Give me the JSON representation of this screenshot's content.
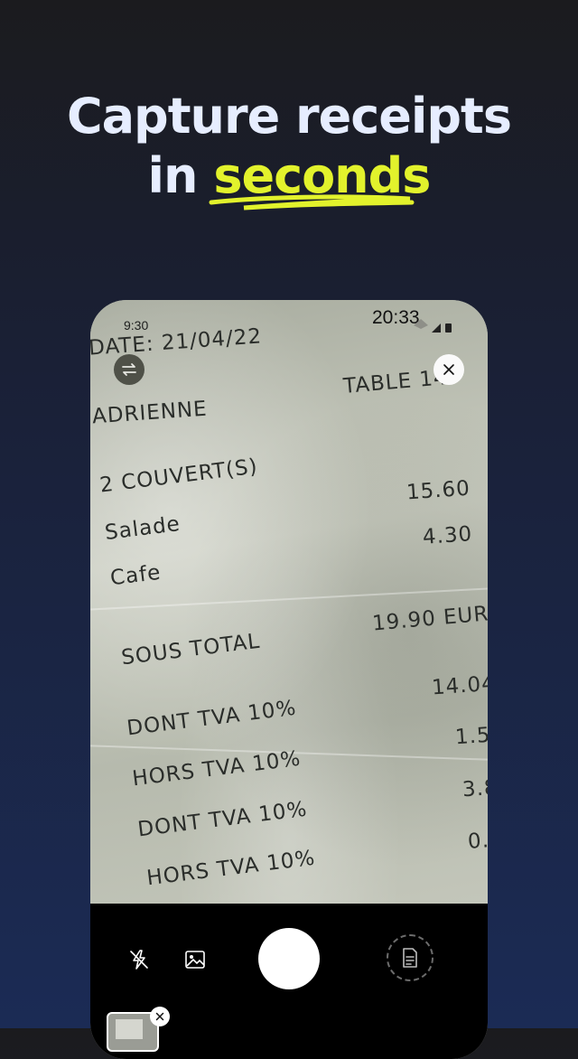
{
  "headline": {
    "line1": "Capture receipts",
    "line2_prefix": "in",
    "line2_accent": "seconds"
  },
  "colors": {
    "accent": "#e2f22c",
    "headline": "#e6edff",
    "background_bottom": "#1b2b55"
  },
  "phone": {
    "status_time": "9:30",
    "status_time_overlay": "20:33",
    "receipt": {
      "date": "DATE: 21/04/22",
      "table": "TABLE 14",
      "server": "ADRIENNE",
      "covers": "2 COUVERT(S)",
      "items": [
        {
          "name": "Salade",
          "amount": "15.60"
        },
        {
          "name": "Cafe",
          "amount": "4.30"
        }
      ],
      "subtotal_label": "SOUS TOTAL",
      "subtotal_value": "19.90 EUR",
      "tax_lines": [
        {
          "label": "DONT TVA 10%",
          "amount": "14.04"
        },
        {
          "label": "HORS TVA 10%",
          "amount": "1.5"
        },
        {
          "label": "DONT TVA 10%",
          "amount": "3.8"
        },
        {
          "label": "HORS TVA 10%",
          "amount": "0."
        }
      ]
    },
    "controls": {
      "switch_icon": "swap-icon",
      "close_icon": "close-icon",
      "flash_icon": "flash-off-icon",
      "gallery_icon": "image-icon",
      "shutter": "shutter-button",
      "document_icon": "document-icon"
    }
  }
}
